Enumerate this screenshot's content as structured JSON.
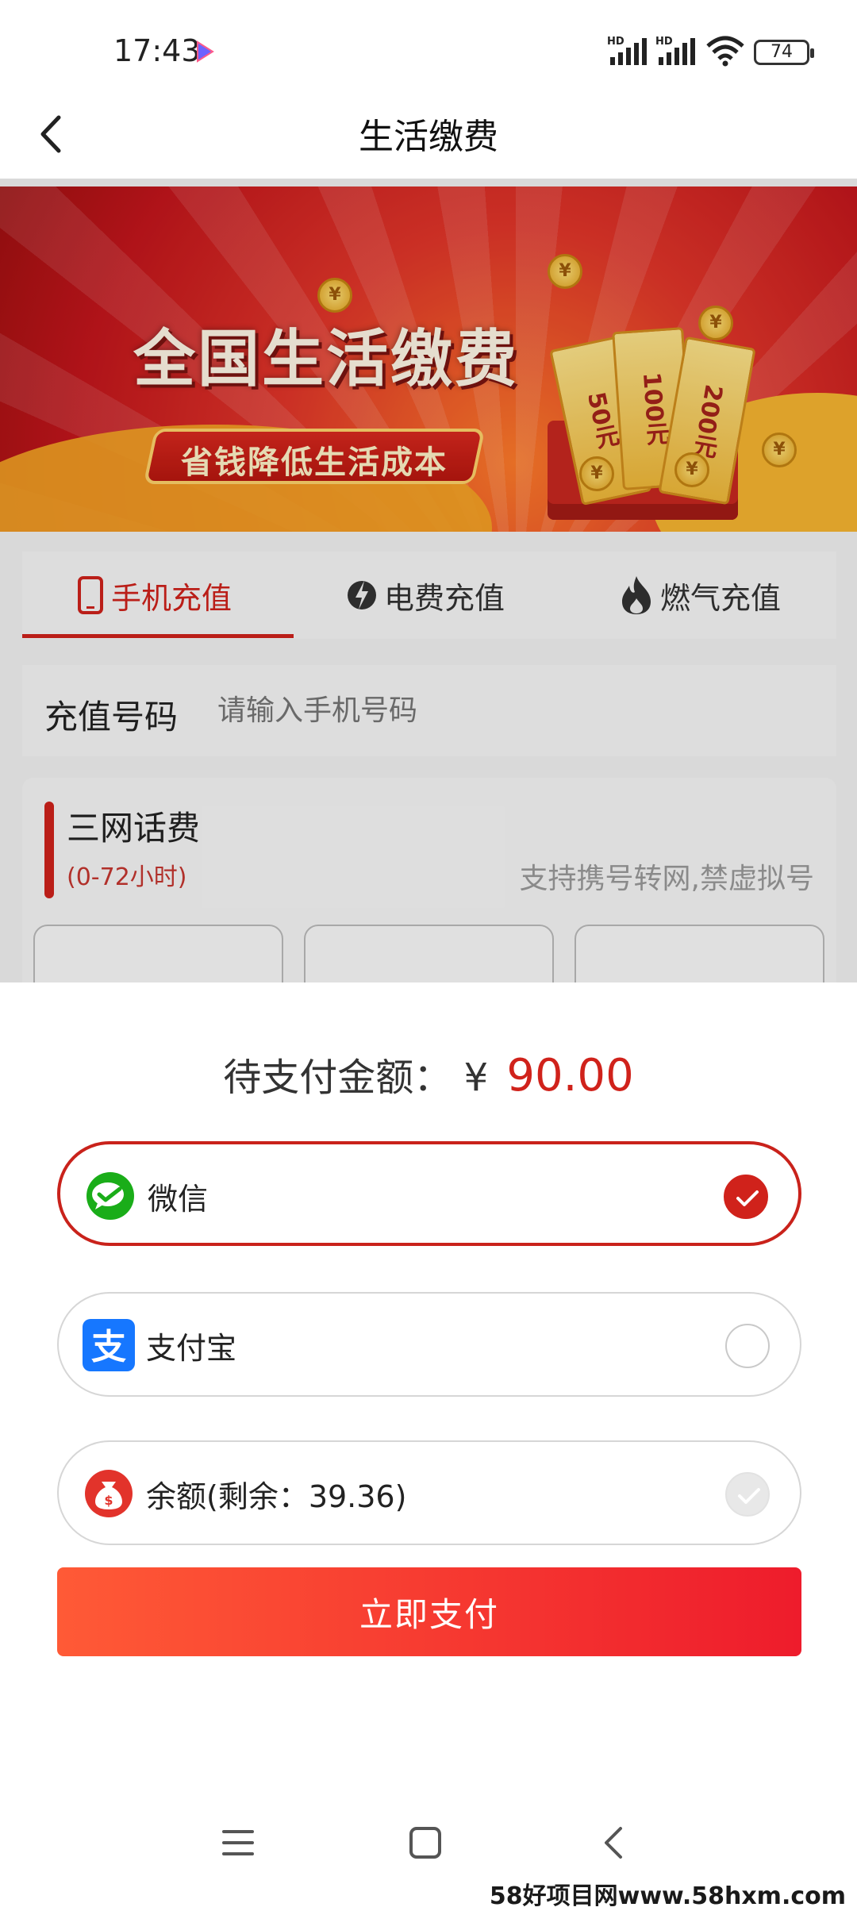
{
  "status_bar": {
    "time": "17:43",
    "battery": "74",
    "signal1": "HD",
    "signal2": "HD"
  },
  "header": {
    "title": "生活缴费"
  },
  "banner": {
    "headline": "全国生活缴费",
    "tagline": "省钱降低生活成本",
    "tickets": [
      "50元",
      "100元",
      "200元"
    ],
    "coin_symbol": "¥"
  },
  "tabs": [
    {
      "label": "手机充值",
      "active": true,
      "icon": "phone-icon"
    },
    {
      "label": "电费充值",
      "active": false,
      "icon": "lightning-icon"
    },
    {
      "label": "燃气充值",
      "active": false,
      "icon": "flame-icon"
    }
  ],
  "recharge": {
    "label": "充值号码",
    "placeholder": "请输入手机号码"
  },
  "plan": {
    "title": "三网话费",
    "hours": "(0-72小时)",
    "note": "支持携号转网,禁虚拟号"
  },
  "payment": {
    "label": "待支付金额：",
    "currency": "¥",
    "amount": "90.00",
    "methods": [
      {
        "name": "微信",
        "icon": "wechat-icon",
        "state": "selected"
      },
      {
        "name": "支付宝",
        "icon": "alipay-icon",
        "state": "unselected"
      },
      {
        "name": "余额(剩余：39.36)",
        "icon": "money-bag-icon",
        "state": "disabled"
      }
    ],
    "button": "立即支付"
  },
  "watermark": "58好项目网www.58hxm.com",
  "colors": {
    "accent": "#d0221b",
    "button_start": "#ff5a36",
    "button_end": "#ee1c2c"
  }
}
